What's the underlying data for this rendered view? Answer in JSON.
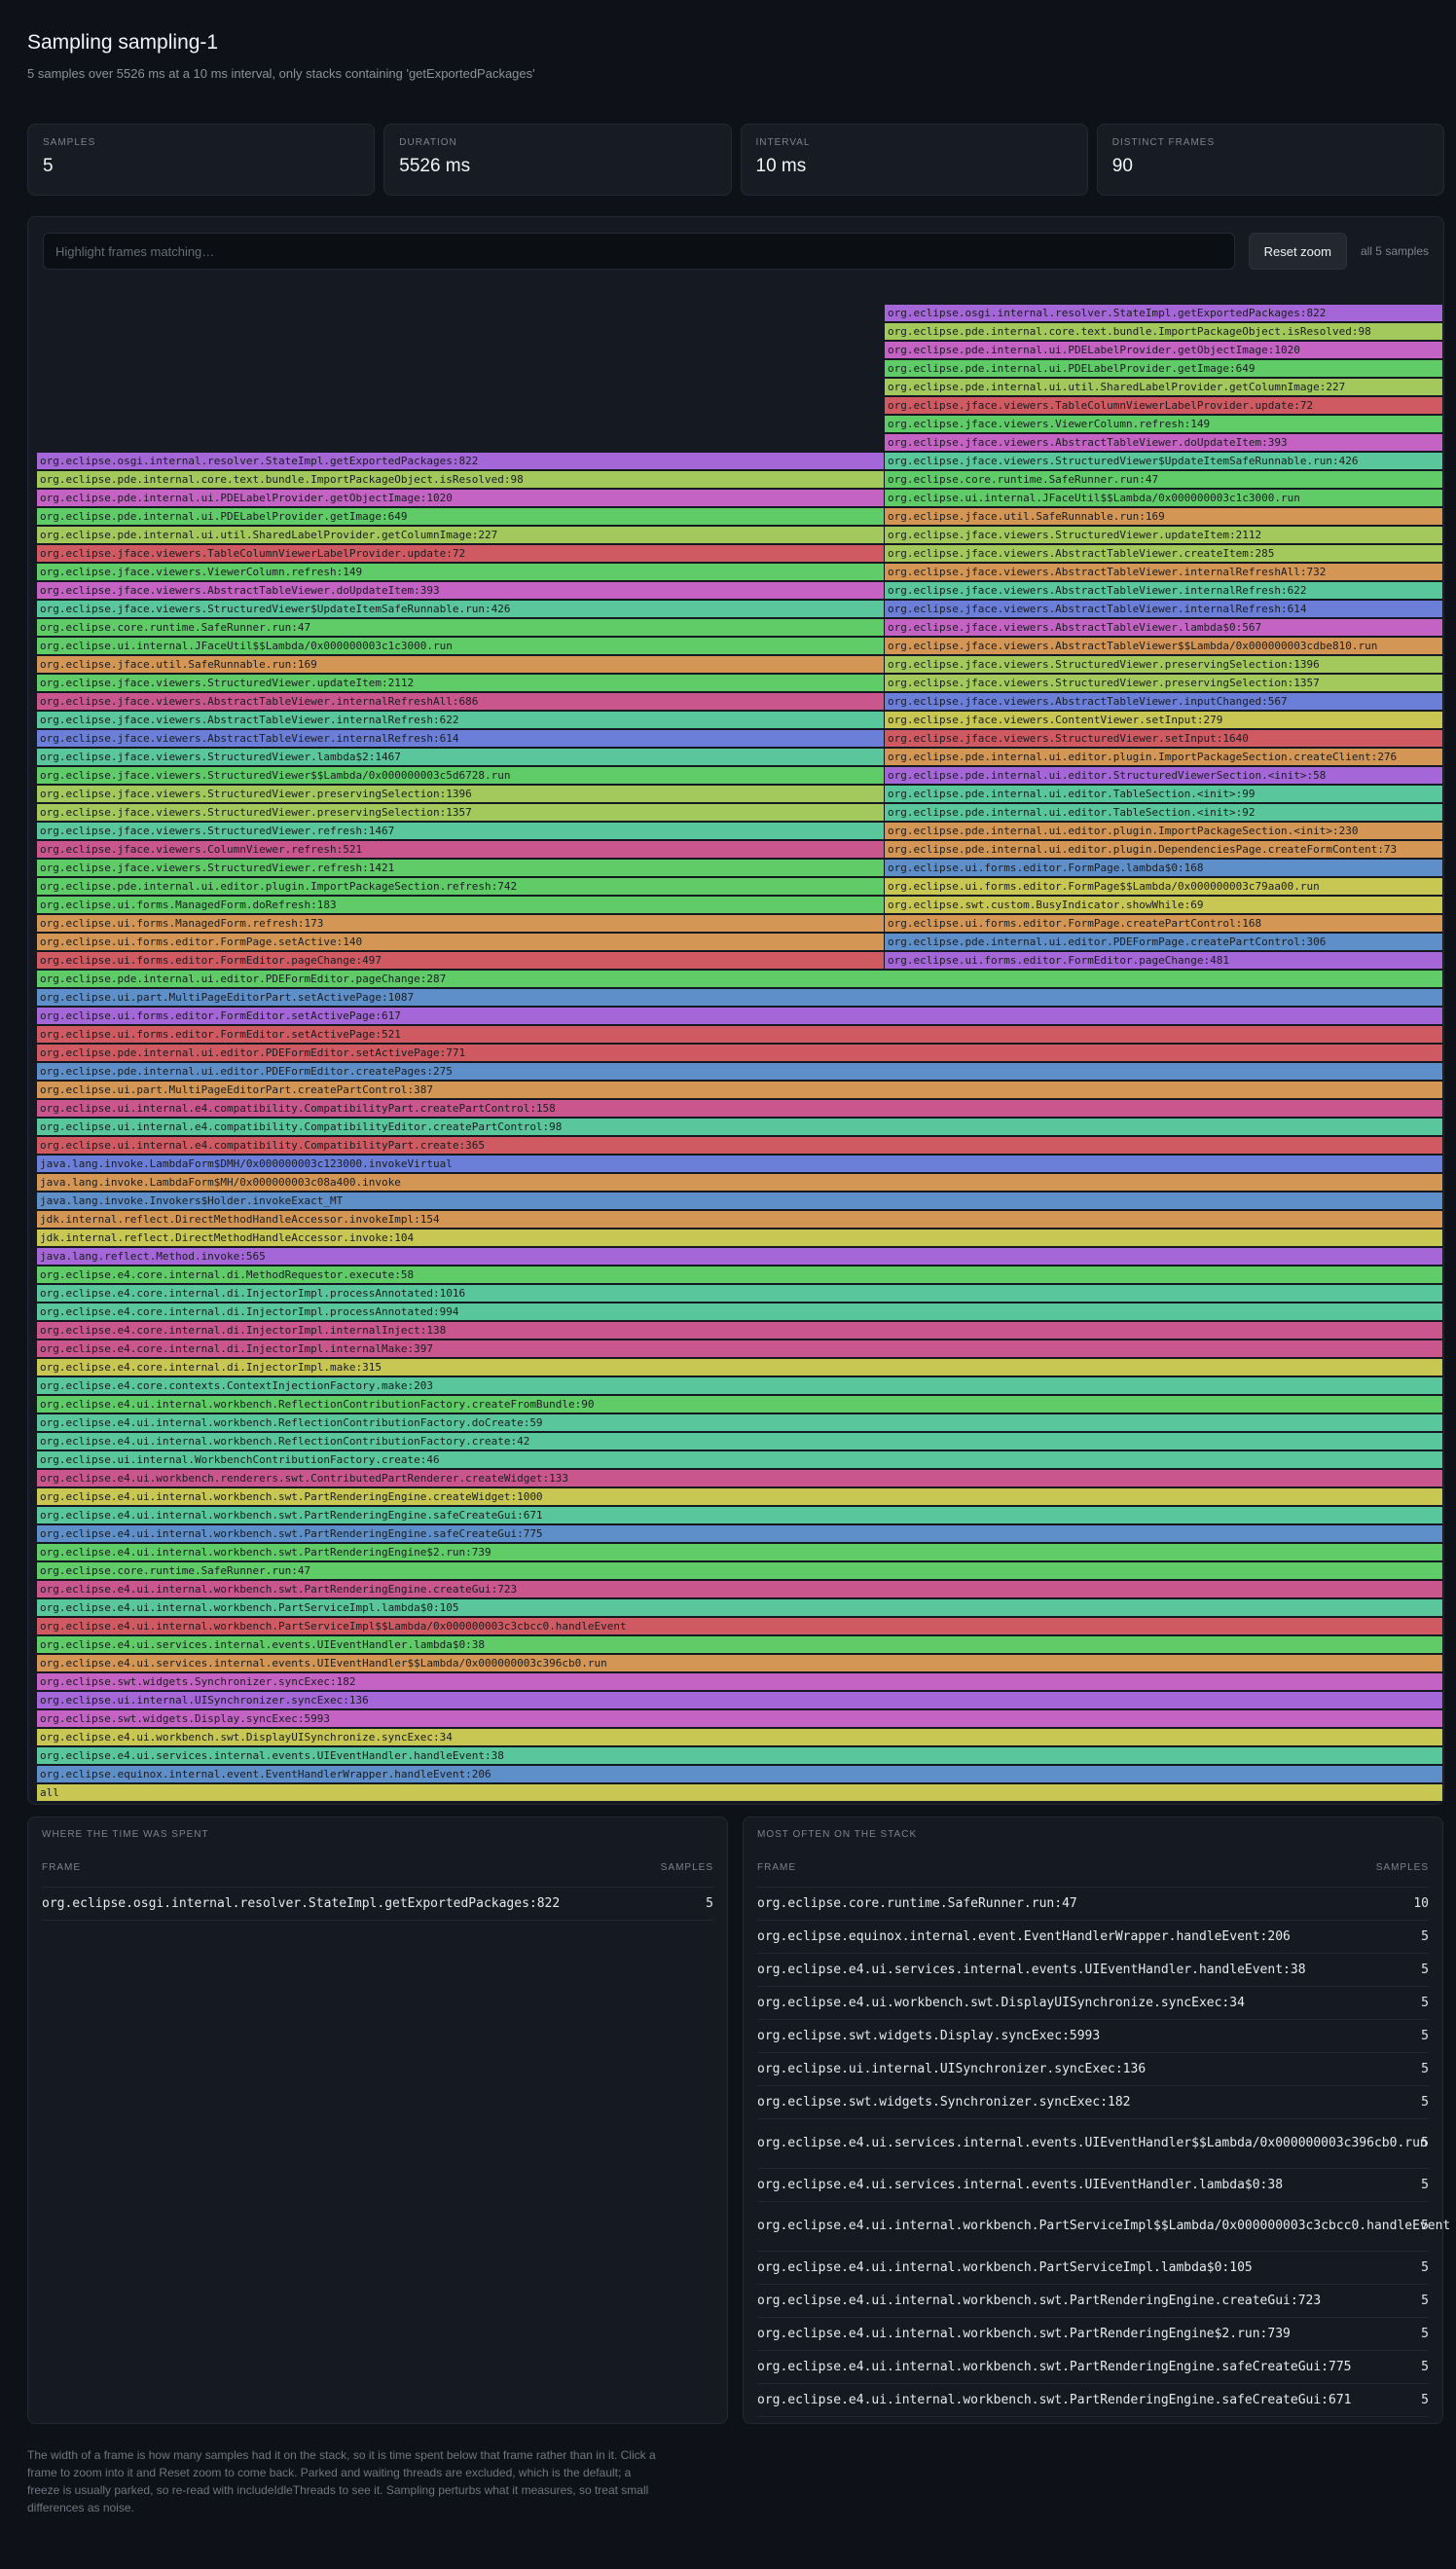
{
  "header": {
    "title": "Sampling sampling-1",
    "subtitle": "5 samples over 5526 ms at a 10 ms interval, only stacks containing 'getExportedPackages'"
  },
  "stats": [
    {
      "label": "SAMPLES",
      "value": "5"
    },
    {
      "label": "DURATION",
      "value": "5526 ms"
    },
    {
      "label": "INTERVAL",
      "value": "10 ms"
    },
    {
      "label": "DISTINCT FRAMES",
      "value": "90"
    }
  ],
  "toolbar": {
    "placeholder": "Highlight frames matching…",
    "reset_label": "Reset zoom",
    "count": "all 5 samples"
  },
  "flamegraph": {
    "base_frames": [
      {
        "label": "all",
        "color": "#c9c753"
      },
      {
        "label": "org.eclipse.equinox.internal.event.EventHandlerWrapper.handleEvent:206",
        "color": "#5f8fc8"
      },
      {
        "label": "org.eclipse.e4.ui.services.internal.events.UIEventHandler.handleEvent:38",
        "color": "#59c79b"
      },
      {
        "label": "org.eclipse.e4.ui.workbench.swt.DisplayUISynchronize.syncExec:34",
        "color": "#c9c753"
      },
      {
        "label": "org.eclipse.swt.widgets.Display.syncExec:5993",
        "color": "#c463c4"
      },
      {
        "label": "org.eclipse.ui.internal.UISynchronizer.syncExec:136",
        "color": "#a566d8"
      },
      {
        "label": "org.eclipse.swt.widgets.Synchronizer.syncExec:182",
        "color": "#c463c4"
      },
      {
        "label": "org.eclipse.e4.ui.services.internal.events.UIEventHandler$$Lambda/0x000000003c396cb0.run",
        "color": "#d49654"
      },
      {
        "label": "org.eclipse.e4.ui.services.internal.events.UIEventHandler.lambda$0:38",
        "color": "#5fcc68"
      },
      {
        "label": "org.eclipse.e4.ui.internal.workbench.PartServiceImpl$$Lambda/0x000000003c3cbcc0.handleEvent",
        "color": "#cf5a62"
      },
      {
        "label": "org.eclipse.e4.ui.internal.workbench.PartServiceImpl.lambda$0:105",
        "color": "#59c79b"
      },
      {
        "label": "org.eclipse.e4.ui.internal.workbench.swt.PartRenderingEngine.createGui:723",
        "color": "#c9568c"
      },
      {
        "label": "org.eclipse.core.runtime.SafeRunner.run:47",
        "color": "#5fcc68"
      },
      {
        "label": "org.eclipse.e4.ui.internal.workbench.swt.PartRenderingEngine$2.run:739",
        "color": "#5fcc68"
      },
      {
        "label": "org.eclipse.e4.ui.internal.workbench.swt.PartRenderingEngine.safeCreateGui:775",
        "color": "#5f8fc8"
      },
      {
        "label": "org.eclipse.e4.ui.internal.workbench.swt.PartRenderingEngine.safeCreateGui:671",
        "color": "#59c79b"
      },
      {
        "label": "org.eclipse.e4.ui.internal.workbench.swt.PartRenderingEngine.createWidget:1000",
        "color": "#c9c753"
      },
      {
        "label": "org.eclipse.e4.ui.workbench.renderers.swt.ContributedPartRenderer.createWidget:133",
        "color": "#c9568c"
      },
      {
        "label": "org.eclipse.ui.internal.WorkbenchContributionFactory.create:46",
        "color": "#59c79b"
      },
      {
        "label": "org.eclipse.e4.ui.internal.workbench.ReflectionContributionFactory.create:42",
        "color": "#59c79b"
      },
      {
        "label": "org.eclipse.e4.ui.internal.workbench.ReflectionContributionFactory.doCreate:59",
        "color": "#59c79b"
      },
      {
        "label": "org.eclipse.e4.ui.internal.workbench.ReflectionContributionFactory.createFromBundle:90",
        "color": "#5fcc68"
      },
      {
        "label": "org.eclipse.e4.core.contexts.ContextInjectionFactory.make:203",
        "color": "#59c79b"
      },
      {
        "label": "org.eclipse.e4.core.internal.di.InjectorImpl.make:315",
        "color": "#c9c753"
      },
      {
        "label": "org.eclipse.e4.core.internal.di.InjectorImpl.internalMake:397",
        "color": "#c9568c"
      },
      {
        "label": "org.eclipse.e4.core.internal.di.InjectorImpl.internalInject:138",
        "color": "#c9568c"
      },
      {
        "label": "org.eclipse.e4.core.internal.di.InjectorImpl.processAnnotated:994",
        "color": "#59c79b"
      },
      {
        "label": "org.eclipse.e4.core.internal.di.InjectorImpl.processAnnotated:1016",
        "color": "#59c79b"
      },
      {
        "label": "org.eclipse.e4.core.internal.di.MethodRequestor.execute:58",
        "color": "#5fcc68"
      },
      {
        "label": "java.lang.reflect.Method.invoke:565",
        "color": "#a566d8"
      },
      {
        "label": "jdk.internal.reflect.DirectMethodHandleAccessor.invoke:104",
        "color": "#c9c753"
      },
      {
        "label": "jdk.internal.reflect.DirectMethodHandleAccessor.invokeImpl:154",
        "color": "#d49654"
      },
      {
        "label": "java.lang.invoke.Invokers$Holder.invokeExact_MT",
        "color": "#5f8fc8"
      },
      {
        "label": "java.lang.invoke.LambdaForm$MH/0x000000003c08a400.invoke",
        "color": "#d49654"
      },
      {
        "label": "java.lang.invoke.LambdaForm$DMH/0x000000003c123000.invokeVirtual",
        "color": "#6b7ed8"
      },
      {
        "label": "org.eclipse.ui.internal.e4.compatibility.CompatibilityPart.create:365",
        "color": "#cf5a62"
      },
      {
        "label": "org.eclipse.ui.internal.e4.compatibility.CompatibilityEditor.createPartControl:98",
        "color": "#59c79b"
      },
      {
        "label": "org.eclipse.ui.internal.e4.compatibility.CompatibilityPart.createPartControl:158",
        "color": "#c9568c"
      },
      {
        "label": "org.eclipse.ui.part.MultiPageEditorPart.createPartControl:387",
        "color": "#d49654"
      },
      {
        "label": "org.eclipse.pde.internal.ui.editor.PDEFormEditor.createPages:275",
        "color": "#5f8fc8"
      },
      {
        "label": "org.eclipse.pde.internal.ui.editor.PDEFormEditor.setActivePage:771",
        "color": "#cf5a62"
      },
      {
        "label": "org.eclipse.ui.forms.editor.FormEditor.setActivePage:521",
        "color": "#cf5a62"
      },
      {
        "label": "org.eclipse.ui.forms.editor.FormEditor.setActivePage:617",
        "color": "#a566d8"
      },
      {
        "label": "org.eclipse.ui.part.MultiPageEditorPart.setActivePage:1087",
        "color": "#5f8fc8"
      },
      {
        "label": "org.eclipse.pde.internal.ui.editor.PDEFormEditor.pageChange:287",
        "color": "#5fcc68"
      }
    ],
    "left_frames": [
      {
        "label": "org.eclipse.ui.forms.editor.FormEditor.pageChange:497",
        "color": "#cf5a62"
      },
      {
        "label": "org.eclipse.ui.forms.editor.FormPage.setActive:140",
        "color": "#d49654"
      },
      {
        "label": "org.eclipse.ui.forms.ManagedForm.refresh:173",
        "color": "#d49654"
      },
      {
        "label": "org.eclipse.ui.forms.ManagedForm.doRefresh:183",
        "color": "#5fcc68"
      },
      {
        "label": "org.eclipse.pde.internal.ui.editor.plugin.ImportPackageSection.refresh:742",
        "color": "#5fcc68"
      },
      {
        "label": "org.eclipse.jface.viewers.StructuredViewer.refresh:1421",
        "color": "#5fcc68"
      },
      {
        "label": "org.eclipse.jface.viewers.ColumnViewer.refresh:521",
        "color": "#c9568c"
      },
      {
        "label": "org.eclipse.jface.viewers.StructuredViewer.refresh:1467",
        "color": "#59c79b"
      },
      {
        "label": "org.eclipse.jface.viewers.StructuredViewer.preservingSelection:1357",
        "color": "#a3c95c"
      },
      {
        "label": "org.eclipse.jface.viewers.StructuredViewer.preservingSelection:1396",
        "color": "#a3c95c"
      },
      {
        "label": "org.eclipse.jface.viewers.StructuredViewer$$Lambda/0x000000003c5d6728.run",
        "color": "#5fcc68"
      },
      {
        "label": "org.eclipse.jface.viewers.StructuredViewer.lambda$2:1467",
        "color": "#59c79b"
      },
      {
        "label": "org.eclipse.jface.viewers.AbstractTableViewer.internalRefresh:614",
        "color": "#6b7ed8"
      },
      {
        "label": "org.eclipse.jface.viewers.AbstractTableViewer.internalRefresh:622",
        "color": "#59c79b"
      },
      {
        "label": "org.eclipse.jface.viewers.AbstractTableViewer.internalRefreshAll:686",
        "color": "#c9568c"
      },
      {
        "label": "org.eclipse.jface.viewers.StructuredViewer.updateItem:2112",
        "color": "#5fcc68"
      },
      {
        "label": "org.eclipse.jface.util.SafeRunnable.run:169",
        "color": "#d49654"
      },
      {
        "label": "org.eclipse.ui.internal.JFaceUtil$$Lambda/0x000000003c1c3000.run",
        "color": "#5fcc68"
      },
      {
        "label": "org.eclipse.core.runtime.SafeRunner.run:47",
        "color": "#5fcc68"
      },
      {
        "label": "org.eclipse.jface.viewers.StructuredViewer$UpdateItemSafeRunnable.run:426",
        "color": "#59c79b"
      },
      {
        "label": "org.eclipse.jface.viewers.AbstractTableViewer.doUpdateItem:393",
        "color": "#c463c4"
      },
      {
        "label": "org.eclipse.jface.viewers.ViewerColumn.refresh:149",
        "color": "#5fcc68"
      },
      {
        "label": "org.eclipse.jface.viewers.TableColumnViewerLabelProvider.update:72",
        "color": "#cf5a62"
      },
      {
        "label": "org.eclipse.pde.internal.ui.util.SharedLabelProvider.getColumnImage:227",
        "color": "#a3c95c"
      },
      {
        "label": "org.eclipse.pde.internal.ui.PDELabelProvider.getImage:649",
        "color": "#5fcc68"
      },
      {
        "label": "org.eclipse.pde.internal.ui.PDELabelProvider.getObjectImage:1020",
        "color": "#c463c4"
      },
      {
        "label": "org.eclipse.pde.internal.core.text.bundle.ImportPackageObject.isResolved:98",
        "color": "#a3c95c"
      },
      {
        "label": "org.eclipse.osgi.internal.resolver.StateImpl.getExportedPackages:822",
        "color": "#a566d8"
      }
    ],
    "right_frames": [
      {
        "label": "org.eclipse.ui.forms.editor.FormEditor.pageChange:481",
        "color": "#a566d8"
      },
      {
        "label": "org.eclipse.pde.internal.ui.editor.PDEFormPage.createPartControl:306",
        "color": "#5f8fc8"
      },
      {
        "label": "org.eclipse.ui.forms.editor.FormPage.createPartControl:168",
        "color": "#d49654"
      },
      {
        "label": "org.eclipse.swt.custom.BusyIndicator.showWhile:69",
        "color": "#c9c753"
      },
      {
        "label": "org.eclipse.ui.forms.editor.FormPage$$Lambda/0x000000003c79aa00.run",
        "color": "#c9c753"
      },
      {
        "label": "org.eclipse.ui.forms.editor.FormPage.lambda$0:168",
        "color": "#5f8fc8"
      },
      {
        "label": "org.eclipse.pde.internal.ui.editor.plugin.DependenciesPage.createFormContent:73",
        "color": "#d49654"
      },
      {
        "label": "org.eclipse.pde.internal.ui.editor.plugin.ImportPackageSection.<init>:230",
        "color": "#d49654"
      },
      {
        "label": "org.eclipse.pde.internal.ui.editor.TableSection.<init>:92",
        "color": "#59c79b"
      },
      {
        "label": "org.eclipse.pde.internal.ui.editor.TableSection.<init>:99",
        "color": "#59c79b"
      },
      {
        "label": "org.eclipse.pde.internal.ui.editor.StructuredViewerSection.<init>:58",
        "color": "#a566d8"
      },
      {
        "label": "org.eclipse.pde.internal.ui.editor.plugin.ImportPackageSection.createClient:276",
        "color": "#d49654"
      },
      {
        "label": "org.eclipse.jface.viewers.StructuredViewer.setInput:1640",
        "color": "#cf5a62"
      },
      {
        "label": "org.eclipse.jface.viewers.ContentViewer.setInput:279",
        "color": "#c9c753"
      },
      {
        "label": "org.eclipse.jface.viewers.AbstractTableViewer.inputChanged:567",
        "color": "#6b7ed8"
      },
      {
        "label": "org.eclipse.jface.viewers.StructuredViewer.preservingSelection:1357",
        "color": "#a3c95c"
      },
      {
        "label": "org.eclipse.jface.viewers.StructuredViewer.preservingSelection:1396",
        "color": "#a3c95c"
      },
      {
        "label": "org.eclipse.jface.viewers.AbstractTableViewer$$Lambda/0x000000003cdbe810.run",
        "color": "#d49654"
      },
      {
        "label": "org.eclipse.jface.viewers.AbstractTableViewer.lambda$0:567",
        "color": "#c463c4"
      },
      {
        "label": "org.eclipse.jface.viewers.AbstractTableViewer.internalRefresh:614",
        "color": "#6b7ed8"
      },
      {
        "label": "org.eclipse.jface.viewers.AbstractTableViewer.internalRefresh:622",
        "color": "#59c79b"
      },
      {
        "label": "org.eclipse.jface.viewers.AbstractTableViewer.internalRefreshAll:732",
        "color": "#d49654"
      },
      {
        "label": "org.eclipse.jface.viewers.AbstractTableViewer.createItem:285",
        "color": "#a3c95c"
      },
      {
        "label": "org.eclipse.jface.viewers.StructuredViewer.updateItem:2112",
        "color": "#a3c95c"
      },
      {
        "label": "org.eclipse.jface.util.SafeRunnable.run:169",
        "color": "#d49654"
      },
      {
        "label": "org.eclipse.ui.internal.JFaceUtil$$Lambda/0x000000003c1c3000.run",
        "color": "#5fcc68"
      },
      {
        "label": "org.eclipse.core.runtime.SafeRunner.run:47",
        "color": "#5fcc68"
      },
      {
        "label": "org.eclipse.jface.viewers.StructuredViewer$UpdateItemSafeRunnable.run:426",
        "color": "#59c79b"
      },
      {
        "label": "org.eclipse.jface.viewers.AbstractTableViewer.doUpdateItem:393",
        "color": "#c463c4"
      },
      {
        "label": "org.eclipse.jface.viewers.ViewerColumn.refresh:149",
        "color": "#5fcc68"
      },
      {
        "label": "org.eclipse.jface.viewers.TableColumnViewerLabelProvider.update:72",
        "color": "#cf5a62"
      },
      {
        "label": "org.eclipse.pde.internal.ui.util.SharedLabelProvider.getColumnImage:227",
        "color": "#a3c95c"
      },
      {
        "label": "org.eclipse.pde.internal.ui.PDELabelProvider.getImage:649",
        "color": "#5fcc68"
      },
      {
        "label": "org.eclipse.pde.internal.ui.PDELabelProvider.getObjectImage:1020",
        "color": "#c463c4"
      },
      {
        "label": "org.eclipse.pde.internal.core.text.bundle.ImportPackageObject.isResolved:98",
        "color": "#a3c95c"
      },
      {
        "label": "org.eclipse.osgi.internal.resolver.StateImpl.getExportedPackages:822",
        "color": "#a566d8"
      }
    ]
  },
  "time_table": {
    "title": "WHERE THE TIME WAS SPENT",
    "frame_header": "FRAME",
    "samples_header": "SAMPLES",
    "rows": [
      {
        "frame": "org.eclipse.osgi.internal.resolver.StateImpl.getExportedPackages:822",
        "samples": "5"
      }
    ]
  },
  "stack_table": {
    "title": "MOST OFTEN ON THE STACK",
    "frame_header": "FRAME",
    "samples_header": "SAMPLES",
    "rows": [
      {
        "frame": "org.eclipse.core.runtime.SafeRunner.run:47",
        "samples": "10"
      },
      {
        "frame": "org.eclipse.equinox.internal.event.EventHandlerWrapper.handleEvent:206",
        "samples": "5"
      },
      {
        "frame": "org.eclipse.e4.ui.services.internal.events.UIEventHandler.handleEvent:38",
        "samples": "5"
      },
      {
        "frame": "org.eclipse.e4.ui.workbench.swt.DisplayUISynchronize.syncExec:34",
        "samples": "5"
      },
      {
        "frame": "org.eclipse.swt.widgets.Display.syncExec:5993",
        "samples": "5"
      },
      {
        "frame": "org.eclipse.ui.internal.UISynchronizer.syncExec:136",
        "samples": "5"
      },
      {
        "frame": "org.eclipse.swt.widgets.Synchronizer.syncExec:182",
        "samples": "5"
      },
      {
        "frame": "org.eclipse.e4.ui.services.internal.events.UIEventHandler$$Lambda/0x000000003c396cb0.run",
        "samples": "5",
        "wrap": true
      },
      {
        "frame": "org.eclipse.e4.ui.services.internal.events.UIEventHandler.lambda$0:38",
        "samples": "5"
      },
      {
        "frame": "org.eclipse.e4.ui.internal.workbench.PartServiceImpl$$Lambda/0x000000003c3cbcc0.handleEvent",
        "samples": "5",
        "wrap": true
      },
      {
        "frame": "org.eclipse.e4.ui.internal.workbench.PartServiceImpl.lambda$0:105",
        "samples": "5"
      },
      {
        "frame": "org.eclipse.e4.ui.internal.workbench.swt.PartRenderingEngine.createGui:723",
        "samples": "5"
      },
      {
        "frame": "org.eclipse.e4.ui.internal.workbench.swt.PartRenderingEngine$2.run:739",
        "samples": "5"
      },
      {
        "frame": "org.eclipse.e4.ui.internal.workbench.swt.PartRenderingEngine.safeCreateGui:775",
        "samples": "5"
      },
      {
        "frame": "org.eclipse.e4.ui.internal.workbench.swt.PartRenderingEngine.safeCreateGui:671",
        "samples": "5"
      }
    ]
  },
  "footer": "The width of a frame is how many samples had it on the stack, so it is time spent below that frame rather than in it. Click a frame to zoom into it and Reset zoom to come back. Parked and waiting threads are excluded, which is the default; a freeze is usually parked, so re-read with includeIdleThreads to see it. Sampling perturbs what it measures, so treat small differences as noise."
}
